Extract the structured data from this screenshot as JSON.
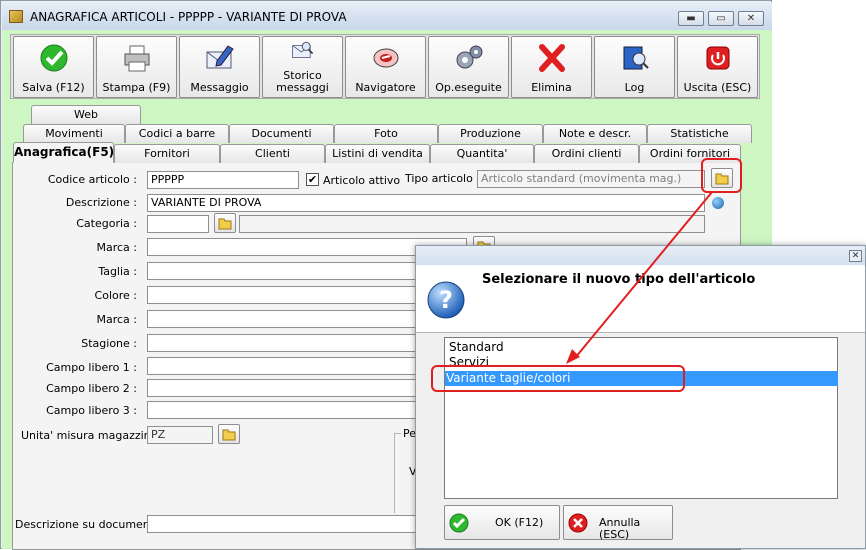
{
  "window": {
    "title": "ANAGRAFICA ARTICOLI - PPPPP - VARIANTE DI PROVA",
    "min_glyph": "▬",
    "max_glyph": "▭",
    "close_glyph": "✕"
  },
  "toolbar": {
    "buttons": [
      {
        "label": "Salva (F12)",
        "icon": "checkmark-icon"
      },
      {
        "label": "Stampa (F9)",
        "icon": "printer-icon"
      },
      {
        "label": "Messaggio",
        "icon": "envelope-pen-icon"
      },
      {
        "label": "Storico messaggi",
        "line1": "Storico",
        "line2": "messaggi",
        "icon": "envelope-search-icon"
      },
      {
        "label": "Navigatore",
        "icon": "compass-icon"
      },
      {
        "label": "Op.eseguite",
        "icon": "gears-icon"
      },
      {
        "label": "Elimina",
        "icon": "red-x-icon"
      },
      {
        "label": "Log",
        "icon": "book-search-icon"
      },
      {
        "label": "Uscita (ESC)",
        "icon": "power-icon"
      }
    ]
  },
  "tabs": {
    "row1": [
      "Web"
    ],
    "row2": [
      "Movimenti",
      "Codici a barre",
      "Documenti",
      "Foto",
      "Produzione",
      "Note e descr.",
      "Statistiche"
    ],
    "row3": [
      "Anagrafica(F5)",
      "Fornitori",
      "Clienti",
      "Listini di vendita",
      "Quantita'",
      "Ordini clienti",
      "Ordini fornitori"
    ],
    "active": "Anagrafica(F5)"
  },
  "form": {
    "codice_label": "Codice articolo :",
    "codice_value": "PPPPP",
    "articolo_attivo_label": "Articolo attivo",
    "articolo_attivo_checked": true,
    "tipo_label": "Tipo articolo :",
    "tipo_value": "Articolo standard (movimenta mag.)",
    "descrizione_label": "Descrizione :",
    "descrizione_value": "VARIANTE DI PROVA",
    "categoria_label": "Categoria :",
    "marca_label": "Marca :",
    "taglia_label": "Taglia :",
    "colore_label": "Colore :",
    "marca2_label": "Marca :",
    "stagione_label": "Stagione :",
    "campo1_label": "Campo libero 1 :",
    "campo2_label": "Campo libero 2 :",
    "campo3_label": "Campo libero 3 :",
    "um_label": "Unita' misura magazzino :",
    "um_value": "PZ",
    "group_label_fragment": "Pe",
    "group_letter_fragment": "V",
    "desc_doc_label": "Descrizione su documenti:"
  },
  "dialog": {
    "header": "Selezionare il nuovo tipo dell'articolo",
    "options": [
      "Standard",
      "Servizi",
      "Variante taglie/colori"
    ],
    "selected_index": 2,
    "ok_label": "OK (F12)",
    "cancel_label": "Annulla (ESC)",
    "close_glyph": "✕"
  },
  "colors": {
    "background_green": "#cdf6c3",
    "selection_blue": "#3399ff",
    "highlight_red": "#e02020"
  }
}
